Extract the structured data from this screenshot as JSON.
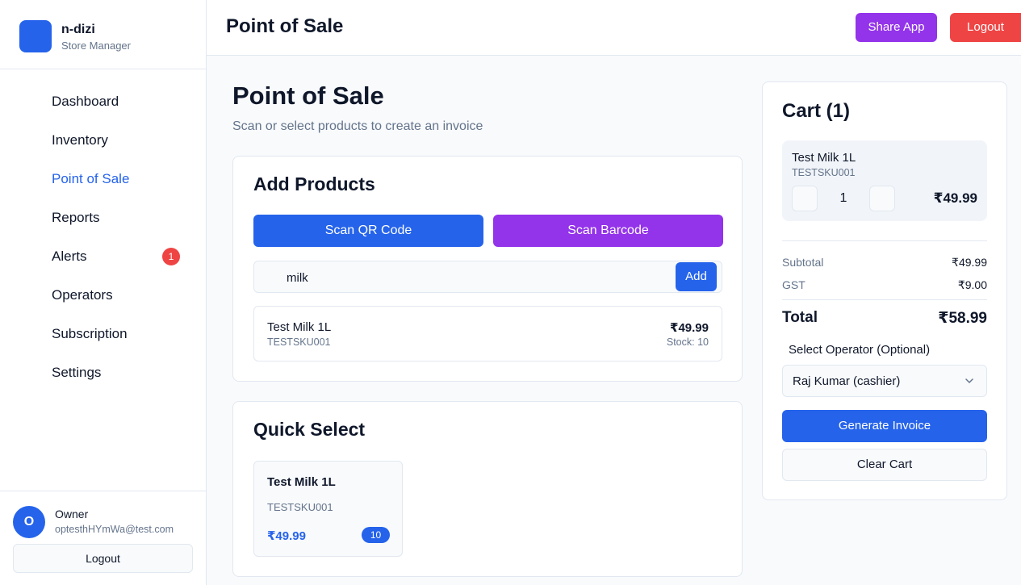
{
  "brand": {
    "name": "n-dizi",
    "subtitle": "Store Manager"
  },
  "sidebar": {
    "items": [
      {
        "label": "Dashboard"
      },
      {
        "label": "Inventory"
      },
      {
        "label": "Point of Sale",
        "active": true
      },
      {
        "label": "Reports"
      },
      {
        "label": "Alerts",
        "badge": "1"
      },
      {
        "label": "Operators"
      },
      {
        "label": "Subscription"
      },
      {
        "label": "Settings"
      }
    ]
  },
  "user": {
    "initial": "O",
    "name": "Owner",
    "email": "optesthHYmWa@test.com",
    "logout_label": "Logout"
  },
  "topbar": {
    "title": "Point of Sale",
    "share_label": "Share App",
    "logout_label": "Logout"
  },
  "page": {
    "title": "Point of Sale",
    "subtitle": "Scan or select products to create an invoice"
  },
  "add_products": {
    "title": "Add Products",
    "scan_qr_label": "Scan QR Code",
    "scan_barcode_label": "Scan Barcode",
    "search_value": "milk",
    "add_label": "Add",
    "result": {
      "name": "Test Milk 1L",
      "sku": "TESTSKU001",
      "price": "₹49.99",
      "stock": "Stock: 10"
    }
  },
  "quick_select": {
    "title": "Quick Select",
    "item": {
      "name": "Test Milk 1L",
      "sku": "TESTSKU001",
      "price": "₹49.99",
      "stock": "10"
    }
  },
  "cart": {
    "title": "Cart (1)",
    "item": {
      "name": "Test Milk 1L",
      "sku": "TESTSKU001",
      "qty": "1",
      "price": "₹49.99"
    },
    "subtotal_label": "Subtotal",
    "subtotal": "₹49.99",
    "gst_label": "GST",
    "gst": "₹9.00",
    "total_label": "Total",
    "total": "₹58.99",
    "operator_label": "Select Operator (Optional)",
    "operator_value": "Raj Kumar (cashier)",
    "generate_label": "Generate Invoice",
    "clear_label": "Clear Cart"
  },
  "colors": {
    "primary": "#2563eb",
    "purple": "#9333ea",
    "danger": "#ef4444"
  }
}
